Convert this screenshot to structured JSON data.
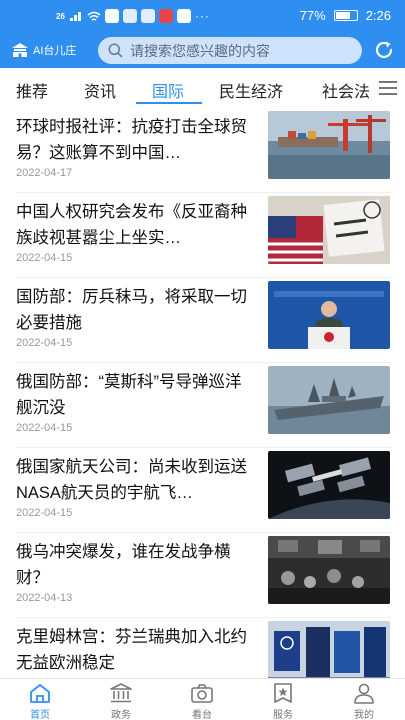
{
  "status_bar": {
    "signal": "26",
    "more": "···",
    "battery": "77%",
    "battery_level": 0.77,
    "time": "2:26"
  },
  "header": {
    "logo_text": "AI台儿庄",
    "search_placeholder": "请搜索您感兴趣的内容"
  },
  "tabs": [
    "推荐",
    "资讯",
    "国际",
    "民生经济",
    "社会法"
  ],
  "active_tab": 2,
  "news": [
    {
      "title": "环球时报社评：抗疫打击全球贸易？这账算不到中国…",
      "date": "2022-04-17",
      "thumb": "port-cranes"
    },
    {
      "title": "中国人权研究会发布《反亚裔种族歧视甚嚣尘上坐实…",
      "date": "2022-04-15",
      "thumb": "protest-sign"
    },
    {
      "title": "国防部：厉兵秣马，将采取一切必要措施",
      "date": "2022-04-15",
      "thumb": "press-conference"
    },
    {
      "title": "俄国防部：“莫斯科”号导弹巡洋舰沉没",
      "date": "2022-04-15",
      "thumb": "warship"
    },
    {
      "title": "俄国家航天公司：尚未收到运送NASA航天员的宇航飞…",
      "date": "2022-04-15",
      "thumb": "space-station"
    },
    {
      "title": "俄乌冲突爆发，谁在发战争横财？",
      "date": "2022-04-13",
      "thumb": "stock-exchange"
    },
    {
      "title": "克里姆林宫：芬兰瑞典加入北约无益欧洲稳定",
      "date": "",
      "thumb": "nato-flags"
    }
  ],
  "bottom_nav": [
    {
      "label": "首页",
      "icon": "home-icon",
      "active": true
    },
    {
      "label": "政务",
      "icon": "government-icon",
      "active": false
    },
    {
      "label": "看台",
      "icon": "camera-icon",
      "active": false
    },
    {
      "label": "服务",
      "icon": "service-star-icon",
      "active": false
    },
    {
      "label": "我的",
      "icon": "user-icon",
      "active": false
    }
  ],
  "colors": {
    "accent": "#2f8ff0",
    "search_bg": "#cfe2fb"
  }
}
